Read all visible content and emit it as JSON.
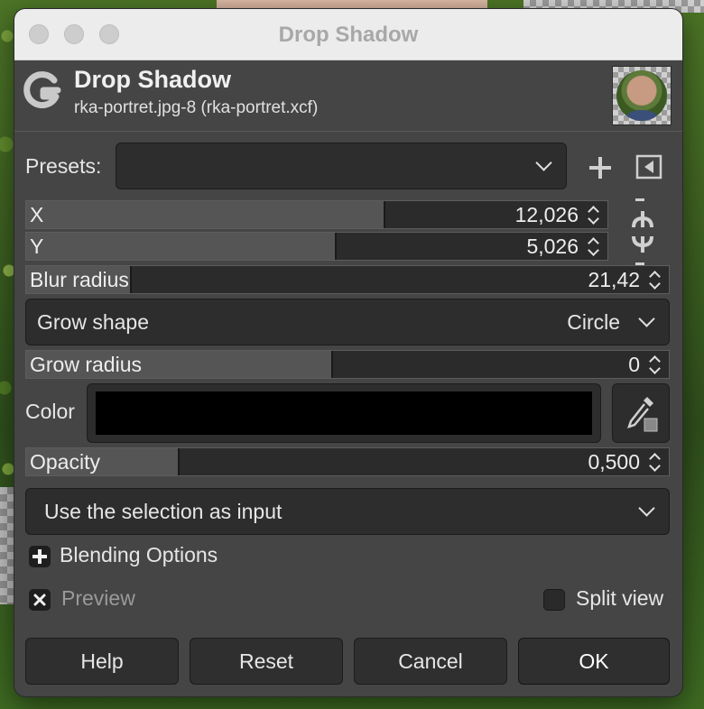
{
  "window": {
    "title": "Drop Shadow"
  },
  "header": {
    "title": "Drop Shadow",
    "subtitle": "rka-portret.jpg-8 (rka-portret.xcf)"
  },
  "presets": {
    "label": "Presets:",
    "value": ""
  },
  "x": {
    "label": "X",
    "value": "12,026",
    "fill_fraction": 0.6
  },
  "y": {
    "label": "Y",
    "value": "5,026",
    "fill_fraction": 0.53
  },
  "blur": {
    "label": "Blur radius",
    "value": "21,42",
    "fill_fraction": 0.16
  },
  "grow_shape": {
    "label": "Grow shape",
    "value": "Circle"
  },
  "grow_radius": {
    "label": "Grow radius",
    "value": "0",
    "fill_fraction": 0.47
  },
  "color": {
    "label": "Color",
    "value": "#000000"
  },
  "opacity": {
    "label": "Opacity",
    "value": "0,500",
    "fill_fraction": 0.23
  },
  "input_mode": {
    "value": "Use the selection as input"
  },
  "blending": {
    "label": "Blending Options"
  },
  "preview": {
    "label": "Preview",
    "checked": true
  },
  "split_view": {
    "label": "Split view",
    "checked": false
  },
  "buttons": {
    "help": "Help",
    "reset": "Reset",
    "cancel": "Cancel",
    "ok": "OK"
  }
}
